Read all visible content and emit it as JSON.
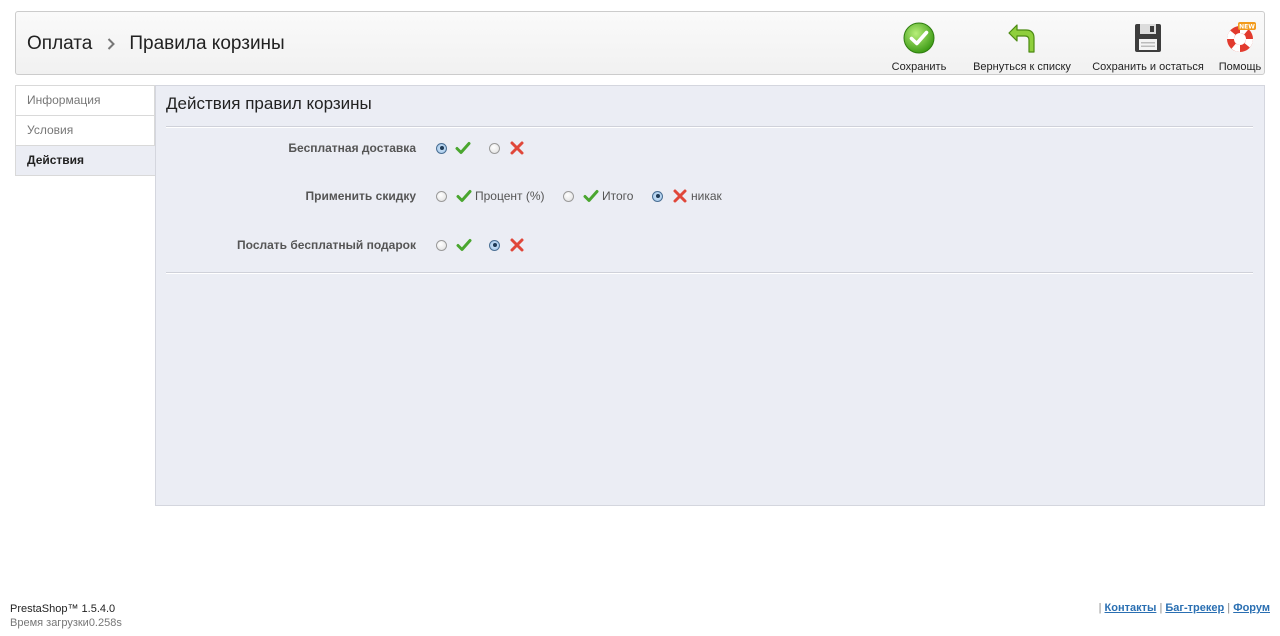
{
  "breadcrumb": {
    "parent": "Оплата",
    "current": "Правила корзины"
  },
  "toolbar": {
    "save": "Сохранить",
    "back": "Вернуться к списку",
    "save_stay": "Сохранить и остаться",
    "help": "Помощь",
    "help_badge": "NEW"
  },
  "tabs": [
    "Информация",
    "Условия",
    "Действия"
  ],
  "panel": {
    "title": "Действия правил корзины",
    "rows": [
      {
        "label": "Бесплатная доставка",
        "selected": "yes"
      },
      {
        "label": "Применить скидку",
        "options": [
          "Процент (%)",
          "Итого",
          "никак"
        ],
        "selected": "никак"
      },
      {
        "label": "Послать бесплатный подарок",
        "selected": "no"
      }
    ]
  },
  "footer": {
    "version": "PrestaShop™ 1.5.4.0",
    "load_time": "Время загрузки0.258s",
    "sep": "|",
    "links": [
      "Контакты",
      "Баг-трекер",
      "Форум"
    ]
  },
  "colors": {
    "accent": "#2a6fb2",
    "check": "#4aa62f",
    "cross": "#e0473a",
    "panel_bg": "#ebedf4"
  }
}
